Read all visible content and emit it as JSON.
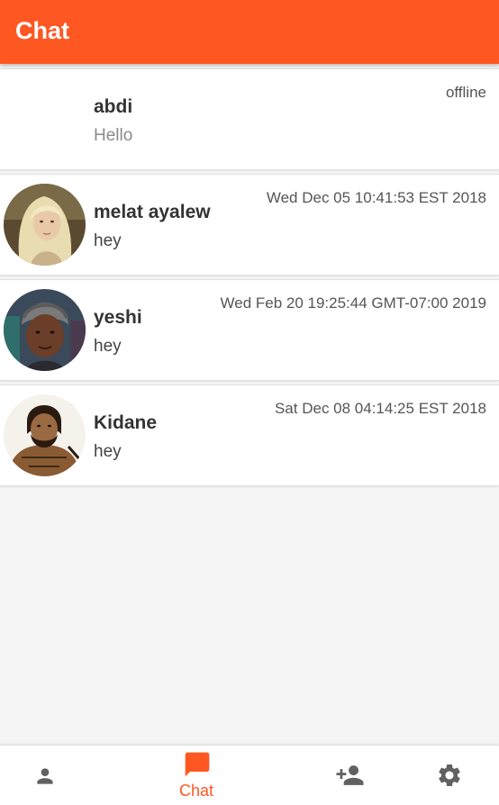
{
  "app": {
    "title": "Chat",
    "accent_color": "#ff5722"
  },
  "chats": [
    {
      "name": "abdi",
      "message": "Hello",
      "time": "offline",
      "avatar": "none"
    },
    {
      "name": "melat ayalew",
      "message": "hey",
      "time": "Wed Dec 05 10:41:53 EST 2018",
      "avatar": "photo-blonde-woman"
    },
    {
      "name": "yeshi",
      "message": "hey",
      "time": "Wed Feb 20 19:25:44 GMT-07:00 2019",
      "avatar": "photo-woman-knit-hat"
    },
    {
      "name": "Kidane",
      "message": "hey",
      "time": "Sat Dec 08 04:14:25 EST 2018",
      "avatar": "photo-bearded-man"
    }
  ],
  "bottom_nav": {
    "items": [
      {
        "icon": "person-icon",
        "label": ""
      },
      {
        "icon": "chat-icon",
        "label": "Chat",
        "active": true
      },
      {
        "icon": "add-person-icon",
        "label": ""
      },
      {
        "icon": "gear-icon",
        "label": ""
      }
    ]
  }
}
